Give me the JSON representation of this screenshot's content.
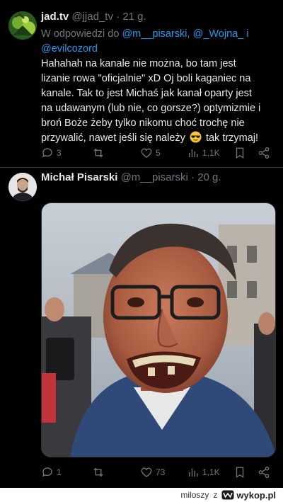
{
  "tweet1": {
    "name": "jad.tv",
    "handle": "@jjad_tv",
    "time": "21 g.",
    "reply_prefix": "W odpowiedzi do",
    "reply_mentions": [
      "@m__pisarski",
      "@_Wojna_",
      "@evilcozord"
    ],
    "reply_joiners": [
      ", ",
      " i"
    ],
    "text_lines": [
      "Hahahah na kanale nie można, bo tam jest",
      "lizanie rowa \"oficjalnie\" xD Oj boli kaganiec na",
      "kanale. Tak to jest Michaś jak kanał oparty jest",
      "na udawanym (lub nie, co gorsze?) optymizmie i",
      "broń Boże żeby tylko nikomu choć trochę nie",
      "przywalić, nawet jeśli się należy"
    ],
    "text_emoji": "sunglasses-emoji",
    "text_tail": "tak trzymaj!",
    "replies": "3",
    "retweets": "",
    "likes": "5",
    "views": "1,1K"
  },
  "tweet2": {
    "name": "Michał Pisarski",
    "handle": "@m__pisarski",
    "time": "20 g.",
    "replies": "1",
    "retweets": "",
    "likes": "73",
    "views": "1,1K"
  },
  "footer": {
    "user": "miloszy",
    "separator": "z",
    "brand": "wykop.pl"
  },
  "colors": {
    "background": "#000000",
    "link": "#1d9bf0",
    "muted": "#71767b",
    "text": "#e7e9ea",
    "divider": "#2f3336"
  },
  "icons": {
    "reply": "reply-icon",
    "retweet": "retweet-icon",
    "like": "heart-icon",
    "views": "views-icon",
    "bookmark": "bookmark-icon",
    "share": "share-icon"
  }
}
